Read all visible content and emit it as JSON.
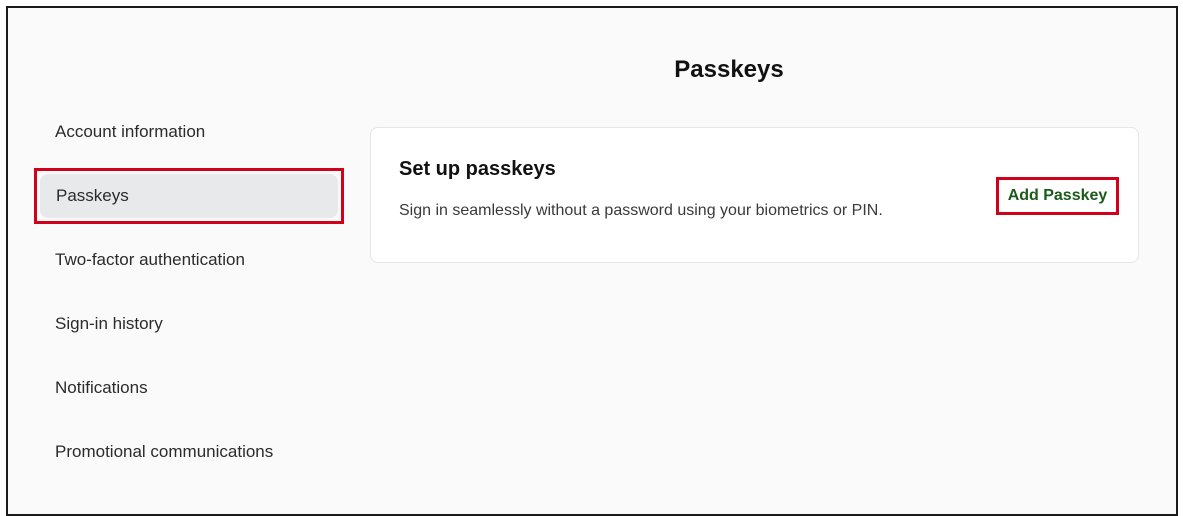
{
  "page": {
    "title": "Passkeys"
  },
  "sidebar": {
    "items": [
      {
        "label": "Account information",
        "active": false
      },
      {
        "label": "Passkeys",
        "active": true
      },
      {
        "label": "Two-factor authentication",
        "active": false
      },
      {
        "label": "Sign-in history",
        "active": false
      },
      {
        "label": "Notifications",
        "active": false
      },
      {
        "label": "Promotional communications",
        "active": false
      }
    ]
  },
  "card": {
    "title": "Set up passkeys",
    "description": "Sign in seamlessly without a password using your biometrics or PIN.",
    "action_label": "Add Passkey"
  },
  "colors": {
    "highlight": "#d0021b",
    "action_text": "#1a5b1a",
    "active_bg": "#e8e9eb"
  }
}
